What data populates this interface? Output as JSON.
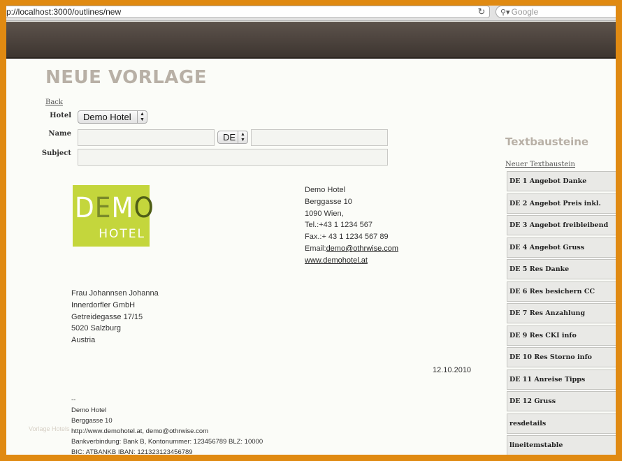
{
  "browser": {
    "url": "p://localhost:3000/outlines/new",
    "search_placeholder": "Google"
  },
  "page": {
    "title": "NEUE VORLAGE",
    "back_label": "Back"
  },
  "form": {
    "hotel_label": "Hotel",
    "hotel_value": "Demo Hotel",
    "name_label": "Name",
    "name_value": "",
    "language_value": "DE",
    "name_translation_value": "",
    "subject_label": "Subject",
    "subject_value": ""
  },
  "letter": {
    "logo_word": "DEMO",
    "logo_sub": "HOTEL",
    "sender": [
      "Demo Hotel",
      "Berggasse 10",
      "1090 Wien,",
      "Tel.:+43 1 1234 567",
      "Fax.:+ 43 1 1234 567 89"
    ],
    "email_prefix": "Email:",
    "email": "demo@othrwise.com",
    "website": "www.demohotel.at",
    "recipient": [
      "Frau Johannsen Johanna",
      "Innerdorfler GmbH",
      "Getreidegasse 17/15",
      "5020 Salzburg",
      "Austria"
    ],
    "date": "12.10.2010",
    "footer": [
      "--",
      "Demo Hotel",
      "Berggasse 10",
      "http://www.demohotel.at, demo@othrwise.com",
      "Bankverbindung: Bank B, Kontonummer: 123456789 BLZ: 10000",
      "BIC: ATBANKB IBAN: 121323123456789"
    ]
  },
  "watermark": "Vorlage Hotels",
  "sidebar": {
    "title": "Textbausteine",
    "new_link": "Neuer Textbaustein",
    "items": [
      "DE 1 Angebot Danke",
      "DE 2 Angebot Preis inkl.",
      "DE 3 Angebot freibleibend",
      "DE 4 Angebot Gruss",
      "DE 5 Res Danke",
      "DE 6 Res besichern CC",
      "DE 7 Res Anzahlung",
      "DE 9 Res CKI info",
      "DE 10 Res Storno info",
      "DE 11 Anreise Tipps",
      "DE 12 Gruss",
      "resdetails",
      "lineitemstable"
    ]
  },
  "colors": {
    "frame_border": "#e08a12",
    "header_band": "#4a413b",
    "logo_bg": "#c4d63c",
    "title_text": "#b8b0a6"
  }
}
